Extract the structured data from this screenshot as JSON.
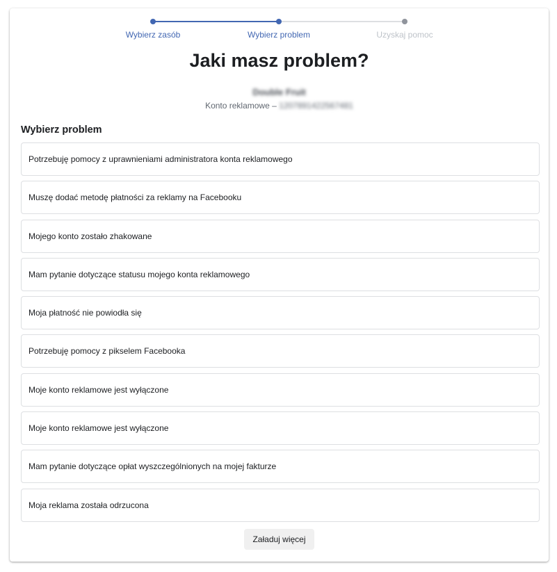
{
  "stepper": {
    "steps": [
      {
        "label": "Wybierz zasób",
        "state": "done"
      },
      {
        "label": "Wybierz problem",
        "state": "current"
      },
      {
        "label": "Uzyskaj pomoc",
        "state": "upcoming"
      }
    ]
  },
  "page": {
    "title": "Jaki masz problem?"
  },
  "account": {
    "name": "Double Fruit",
    "type_label": "Konto reklamowe –",
    "id": "1207891422567481"
  },
  "problems": {
    "heading": "Wybierz problem",
    "items": [
      "Potrzebuję pomocy z uprawnieniami administratora konta reklamowego",
      "Muszę dodać metodę płatności za reklamy na Facebooku",
      "Mojego konto zostało zhakowane",
      "Mam pytanie dotyczące statusu mojego konta reklamowego",
      "Moja płatność nie powiodła się",
      "Potrzebuję pomocy z pikselem Facebooka",
      "Moje konto reklamowe jest wyłączone",
      "Moje konto reklamowe jest wyłączone",
      "Mam pytanie dotyczące opłat wyszczególnionych na mojej fakturze",
      "Moja reklama została odrzucona"
    ],
    "load_more_label": "Załaduj więcej"
  },
  "colors": {
    "accent": "#4267b2",
    "inactive": "#bec3c9",
    "border": "#dddfe2"
  }
}
